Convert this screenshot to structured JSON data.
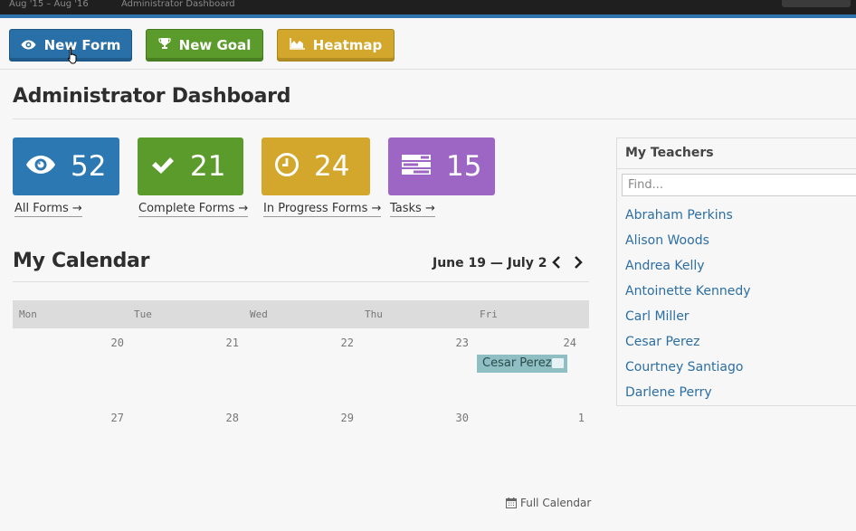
{
  "topbar": {
    "period": "Aug '15 – Aug '16",
    "context": "Administrator Dashboard"
  },
  "actions": {
    "new_form": "New Form",
    "new_goal": "New Goal",
    "heatmap": "Heatmap"
  },
  "page": {
    "title": "Administrator Dashboard"
  },
  "stats": [
    {
      "value": "52",
      "link": "All Forms →",
      "color": "#2b78b2",
      "icon": "eye-icon"
    },
    {
      "value": "21",
      "link": "Complete Forms →",
      "color": "#5a9b2c",
      "icon": "check-icon"
    },
    {
      "value": "24",
      "link": "In Progress Forms →",
      "color": "#d3a72c",
      "icon": "clock-icon"
    },
    {
      "value": "15",
      "link": "Tasks →",
      "color": "#9e66c4",
      "icon": "tasks-icon"
    }
  ],
  "calendar": {
    "title": "My Calendar",
    "range": "June 19 — July 2",
    "days_of_week": [
      "Mon",
      "Tue",
      "Wed",
      "Thu",
      "Fri"
    ],
    "week1": [
      "20",
      "21",
      "22",
      "23",
      "24"
    ],
    "week2": [
      "27",
      "28",
      "29",
      "30",
      "1"
    ],
    "event": {
      "label": "Cesar Perez",
      "day": "24"
    },
    "full_link": "Full Calendar"
  },
  "teachers": {
    "title": "My Teachers",
    "search_placeholder": "Find...",
    "items": [
      "Abraham Perkins",
      "Alison Woods",
      "Andrea Kelly",
      "Antoinette Kennedy",
      "Carl Miller",
      "Cesar Perez",
      "Courtney Santiago",
      "Darlene Perry"
    ]
  }
}
